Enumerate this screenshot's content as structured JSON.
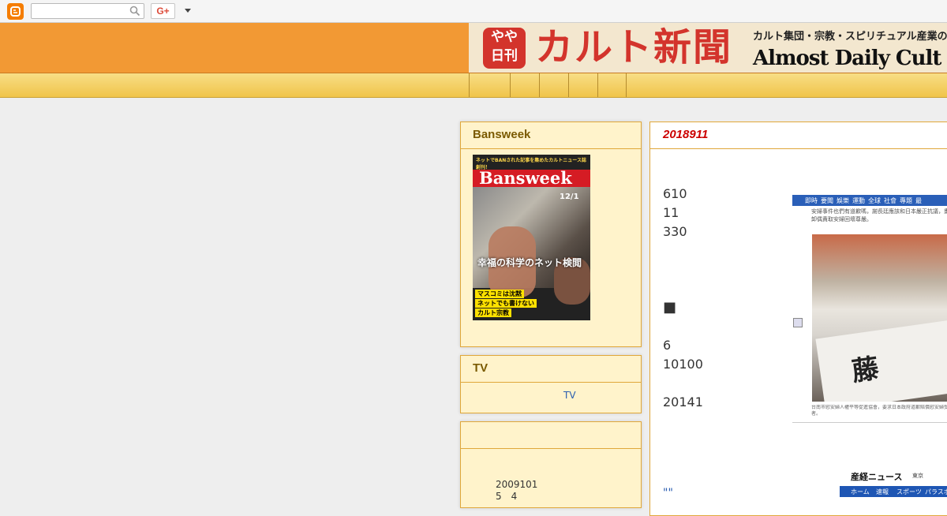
{
  "topbar": {
    "search_placeholder": "",
    "gplus_label": "G+"
  },
  "header": {
    "badge_line1": "やや",
    "badge_line2": "日刊",
    "title": "カルト新聞",
    "subtitle": "カルト集団・宗教・スピリチュアル産業の",
    "english_title": "Almost Daily Cult N"
  },
  "nav": {
    "items": [
      "",
      "",
      "",
      "",
      ""
    ]
  },
  "sidebar": {
    "bansweek": {
      "title": "Bansweek",
      "cover_top": "ネットでBANされた記事を集めたカルトニュース誌創刊！",
      "cover_brand": "Bansweek",
      "cover_date": "12/1",
      "cover_headline": "幸福の科学のネット検閲",
      "cover_tag1": "マスコミは沈黙",
      "cover_tag2": "ネットでも書けない",
      "cover_tag3": "カルト宗教"
    },
    "tv": {
      "title": "TV",
      "link": "TV"
    },
    "archive": {
      "title": "",
      "line1": "2009101",
      "line2": "5　4"
    }
  },
  "post": {
    "title": "2018911",
    "lines": [
      "610",
      "11",
      "330",
      "■",
      "6",
      "10100",
      "20141"
    ],
    "quote": "\"\"",
    "news_nav": [
      "即時",
      "要聞",
      "娛樂",
      "運動",
      "全球",
      "社會",
      "專題",
      "最"
    ],
    "news_text": "安婦事件也們有道歉嗎，謝長廷應該和日本嚴正抗議，畫下卸偶責取安婦回壞尊嚴。",
    "news_banner": "藤",
    "news_caption": "台南市慰安婦人權平等促進協會，要求日本政府道歉賠償慰安婦受害者。",
    "sankei_logo": "産経ニュース",
    "sankei_loc": "東京",
    "sankei_nav": [
      "ホーム",
      "速報",
      "スポーツ",
      "パラスポー"
    ]
  }
}
